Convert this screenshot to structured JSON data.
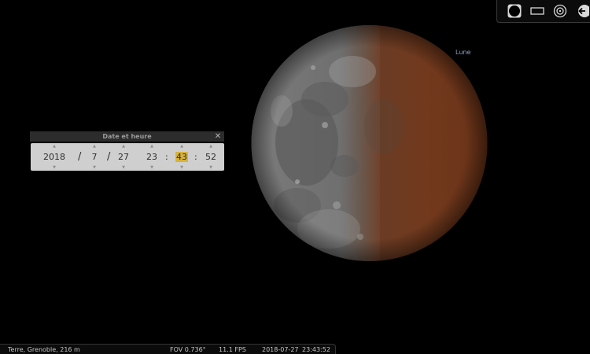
{
  "sky": {
    "object_label": "Lune"
  },
  "toolbar": {
    "buttons": [
      {
        "icon": "circle-filled-icon"
      },
      {
        "icon": "rectangle-icon"
      },
      {
        "icon": "target-circles-icon"
      },
      {
        "icon": "arrow-left-icon"
      }
    ]
  },
  "datetime_window": {
    "title": "Date et heure",
    "close_glyph": "✕",
    "arrow_up": "▲",
    "arrow_down": "▼",
    "date_sep": "/",
    "time_sep": ":",
    "year": "2018",
    "month": "7",
    "day": "27",
    "hour": "23",
    "minute": "43",
    "second": "52"
  },
  "statusbar": {
    "location": "Terre, Grenoble, 216 m",
    "fov": "FOV 0.736°",
    "fps": "11.1 FPS",
    "date": "2018-07-27",
    "time": "23:43:52"
  },
  "colors": {
    "background": "#000000",
    "moon_grey": "#8a8a8a",
    "eclipse_red": "#7a3a1c",
    "highlight": "#d8b33a",
    "label_blue": "#8fa4c8"
  }
}
